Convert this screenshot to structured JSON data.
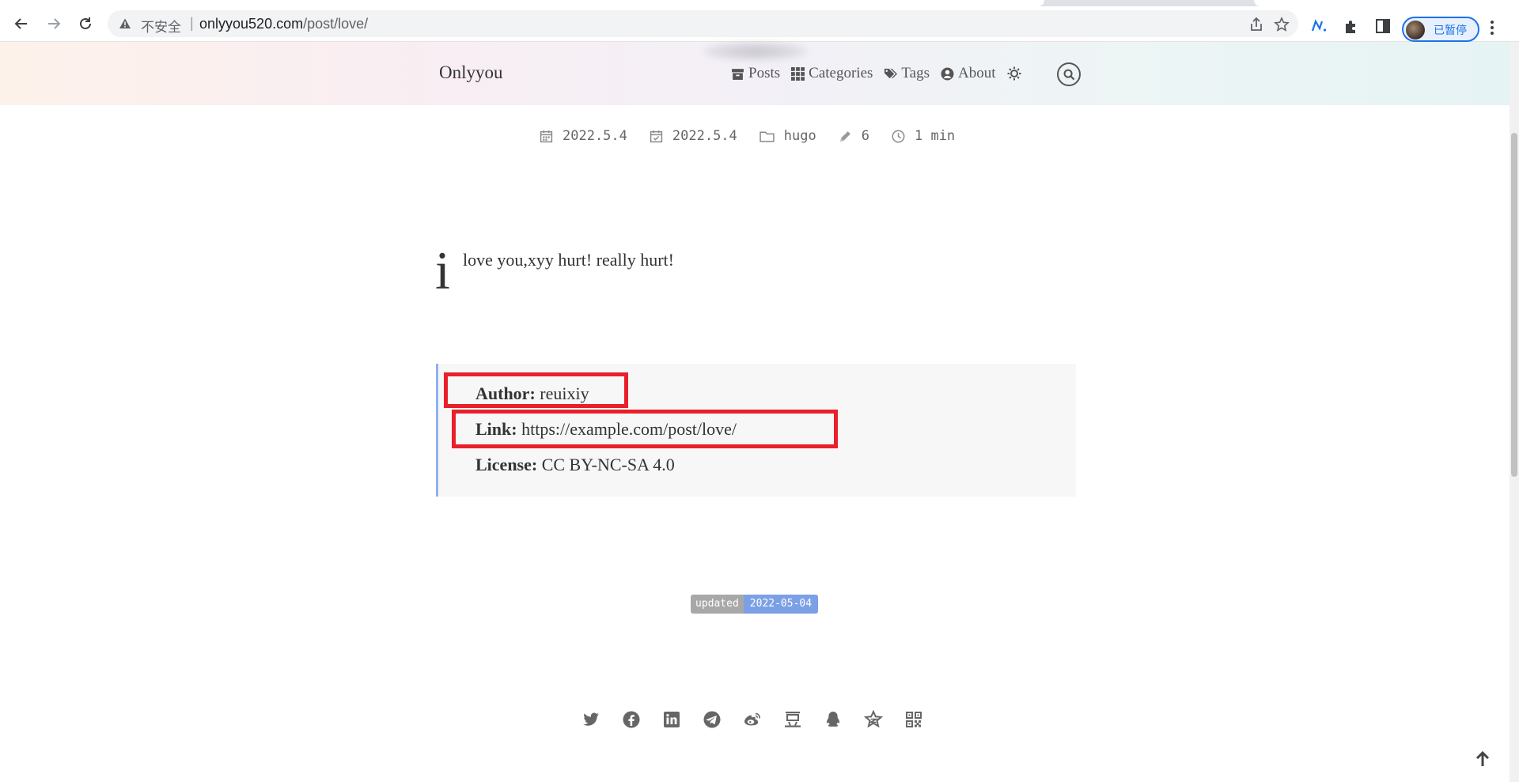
{
  "browser": {
    "security_label": "不安全",
    "separator": "|",
    "url_host": "onlyyou520.com",
    "url_path": "/post/love/",
    "profile_label": "已暂停"
  },
  "site": {
    "brand": "Onlyyou",
    "menu": [
      {
        "label": "Posts",
        "icon": "archive-icon"
      },
      {
        "label": "Categories",
        "icon": "grid-icon"
      },
      {
        "label": "Tags",
        "icon": "tags-icon"
      },
      {
        "label": "About",
        "icon": "user-circle-icon"
      }
    ]
  },
  "post": {
    "meta": {
      "published": "2022.5.4",
      "updated": "2022.5.4",
      "category": "hugo",
      "word_count": "6",
      "reading_time": "1 min"
    },
    "dropcap": "i",
    "body": "love you,xyy hurt! really hurt!",
    "license": {
      "author_label": "Author:",
      "author_value": "reuixiy",
      "link_label": "Link:",
      "link_value": "https://example.com/post/love/",
      "license_label": "License:",
      "license_value": "CC BY-NC-SA 4.0"
    },
    "updated_badge": {
      "key": "updated",
      "value": "2022-05-04"
    }
  },
  "share_icons": [
    "twitter-icon",
    "facebook-icon",
    "linkedin-icon",
    "telegram-icon",
    "weibo-icon",
    "douban-icon",
    "qq-icon",
    "qzone-icon",
    "qrcode-icon"
  ],
  "colors": {
    "highlight_box": "#e8202a",
    "license_border": "#8fb1ee",
    "badge_value_bg": "#7ca0e6",
    "profile_accent": "#1a73e8"
  }
}
